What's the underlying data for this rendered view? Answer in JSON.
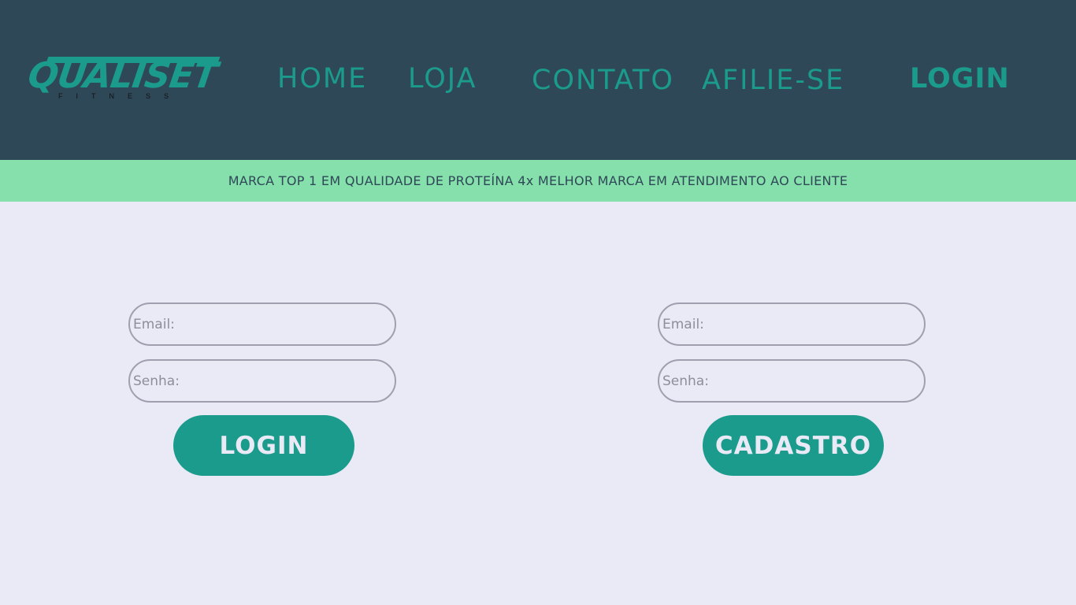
{
  "header": {
    "logo": {
      "name": "QUALISET",
      "tagline": "FITNESS"
    },
    "nav": {
      "home": "HOME",
      "loja": "LOJA",
      "contato": "CONTATO",
      "afilie": "AFILIE-SE",
      "login": "LOGIN"
    }
  },
  "banner": {
    "text": "MARCA TOP 1 EM QUALIDADE DE PROTEÍNA 4x MELHOR MARCA EM ATENDIMENTO AO CLIENTE"
  },
  "login_form": {
    "email_placeholder": "Email:",
    "password_placeholder": "Senha:",
    "submit_label": "LOGIN"
  },
  "signup_form": {
    "email_placeholder": "Email:",
    "password_placeholder": "Senha:",
    "submit_label": "CADASTRO"
  },
  "colors": {
    "header_bg": "#2f4858",
    "accent": "#1b9b8b",
    "banner_bg": "#86e0ab",
    "page_bg": "#e9eaf6"
  }
}
